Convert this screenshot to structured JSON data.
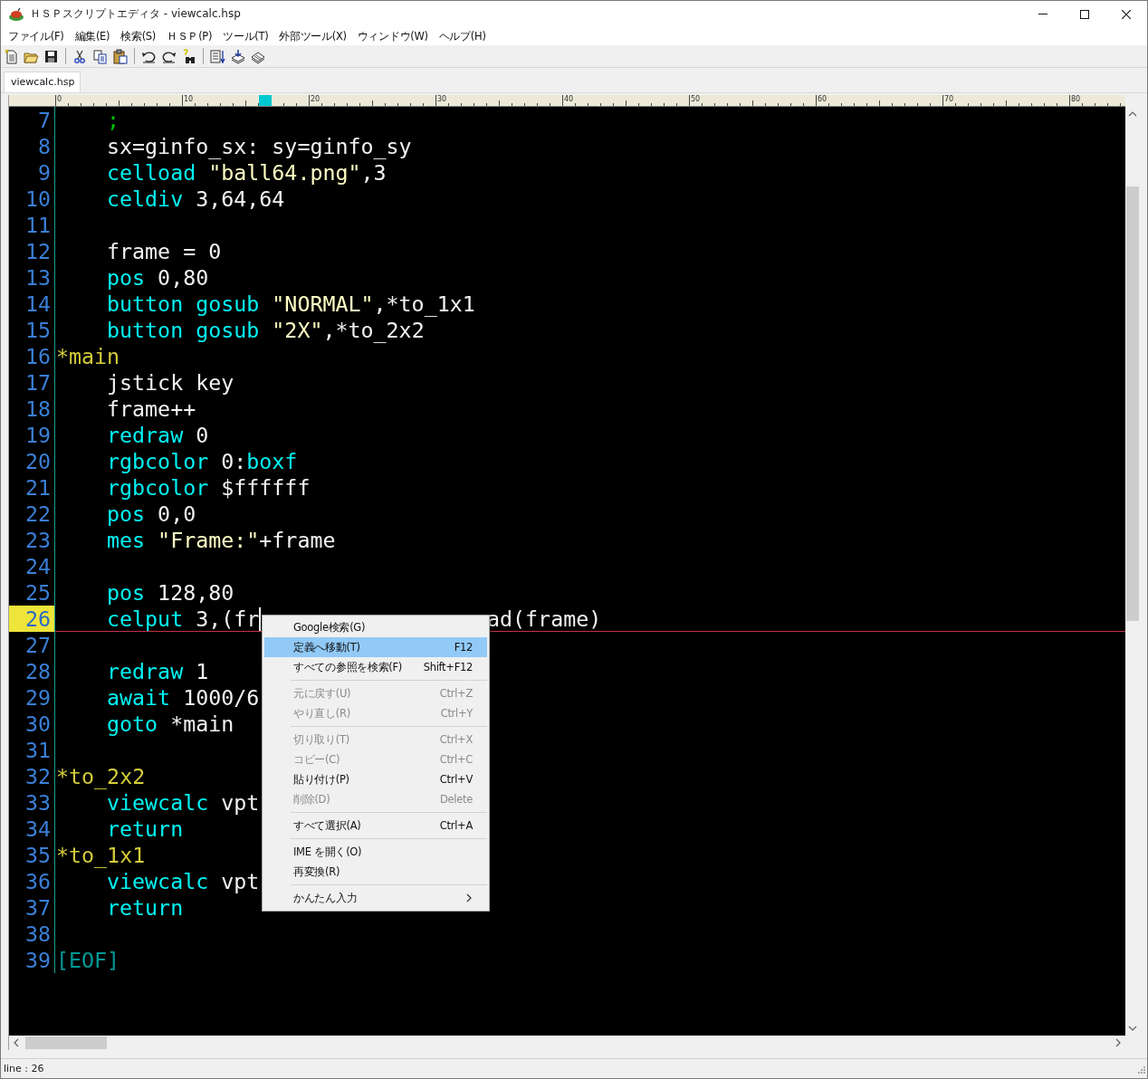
{
  "window": {
    "title": "ＨＳＰスクリプトエディタ - viewcalc.hsp"
  },
  "menu_bar": [
    "ファイル(F)",
    "編集(E)",
    "検索(S)",
    "ＨＳＰ(P)",
    "ツール(T)",
    "外部ツール(X)",
    "ウィンドウ(W)",
    "ヘルプ(H)"
  ],
  "tabs": [
    {
      "label": "viewcalc.hsp",
      "selected": true
    }
  ],
  "ruler": {
    "labels": [
      "0",
      "10",
      "20",
      "30",
      "40",
      "50",
      "60",
      "70",
      "80"
    ],
    "cursor": {
      "level": 0.19
    }
  },
  "editor": {
    "lines": [
      {
        "number": "7",
        "current": false,
        "indent": true,
        "tokens": [
          {
            "kind": "comment",
            "text": ";"
          }
        ]
      },
      {
        "number": "8",
        "current": false,
        "indent": true,
        "tokens": [
          {
            "kind": "plain",
            "text": "sx=ginfo_sx: sy=ginfo_sy"
          }
        ]
      },
      {
        "number": "9",
        "current": false,
        "indent": true,
        "tokens": [
          {
            "kind": "keyword",
            "text": "celload"
          },
          {
            "kind": "string",
            "text": " \"ball64.png\""
          },
          {
            "kind": "plain",
            "text": ",3"
          }
        ]
      },
      {
        "number": "10",
        "current": false,
        "indent": true,
        "tokens": [
          {
            "kind": "keyword",
            "text": "celdiv"
          },
          {
            "kind": "plain",
            "text": " 3,64,64"
          }
        ]
      },
      {
        "number": "11",
        "current": false,
        "indent": false
      },
      {
        "number": "12",
        "current": false,
        "indent": true,
        "tokens": [
          {
            "kind": "plain",
            "text": "frame = 0"
          }
        ]
      },
      {
        "number": "13",
        "current": false,
        "indent": true,
        "tokens": [
          {
            "kind": "keyword",
            "text": "pos"
          },
          {
            "kind": "plain",
            "text": " 0,80"
          }
        ]
      },
      {
        "number": "14",
        "current": false,
        "indent": true,
        "tokens": [
          {
            "kind": "keyword",
            "text": "button gosub"
          },
          {
            "kind": "string",
            "text": " \"NORMAL\""
          },
          {
            "kind": "plain",
            "text": ",*to_1x1"
          }
        ]
      },
      {
        "number": "15",
        "current": false,
        "indent": true,
        "tokens": [
          {
            "kind": "keyword",
            "text": "button gosub"
          },
          {
            "kind": "string",
            "text": " \"2X\""
          },
          {
            "kind": "plain",
            "text": ",*to_2x2"
          }
        ]
      },
      {
        "number": "16",
        "current": false,
        "indent": false,
        "tokens": [
          {
            "kind": "label",
            "text": "*main"
          }
        ]
      },
      {
        "number": "17",
        "current": false,
        "indent": true,
        "tokens": [
          {
            "kind": "plain",
            "text": "jstick key"
          }
        ]
      },
      {
        "number": "18",
        "current": false,
        "indent": true,
        "tokens": [
          {
            "kind": "plain",
            "text": "frame++"
          }
        ]
      },
      {
        "number": "19",
        "current": false,
        "indent": true,
        "tokens": [
          {
            "kind": "keyword",
            "text": "redraw"
          },
          {
            "kind": "plain",
            "text": " 0"
          }
        ]
      },
      {
        "number": "20",
        "current": false,
        "indent": true,
        "tokens": [
          {
            "kind": "keyword",
            "text": "rgbcolor"
          },
          {
            "kind": "plain",
            "text": " 0:"
          },
          {
            "kind": "keyword",
            "text": "boxf"
          }
        ]
      },
      {
        "number": "21",
        "current": false,
        "indent": true,
        "tokens": [
          {
            "kind": "keyword",
            "text": "rgbcolor"
          },
          {
            "kind": "plain",
            "text": " $ffffff"
          }
        ]
      },
      {
        "number": "22",
        "current": false,
        "indent": true,
        "tokens": [
          {
            "kind": "keyword",
            "text": "pos"
          },
          {
            "kind": "plain",
            "text": " 0,0"
          }
        ]
      },
      {
        "number": "23",
        "current": false,
        "indent": true,
        "tokens": [
          {
            "kind": "keyword",
            "text": "mes"
          },
          {
            "kind": "string",
            "text": " \"Frame:\""
          },
          {
            "kind": "plain",
            "text": "+frame"
          }
        ]
      },
      {
        "number": "24",
        "current": false,
        "indent": false
      },
      {
        "number": "25",
        "current": false,
        "indent": true,
        "tokens": [
          {
            "kind": "keyword",
            "text": "pos"
          },
          {
            "kind": "plain",
            "text": " 128,80"
          }
        ]
      },
      {
        "number": "26",
        "current": true,
        "indent": true,
        "tokens": [
          {
            "kind": "keyword",
            "text": "celput"
          },
          {
            "kind": "plain",
            "text": " 3,(fr"
          },
          {
            "kind": "caret"
          },
          {
            "kind": "after_cover",
            "text": "ad(frame)"
          }
        ]
      },
      {
        "number": "27",
        "current": false,
        "indent": false
      },
      {
        "number": "28",
        "current": false,
        "indent": true,
        "tokens": [
          {
            "kind": "keyword",
            "text": "redraw"
          },
          {
            "kind": "plain",
            "text": " 1"
          }
        ]
      },
      {
        "number": "29",
        "current": false,
        "indent": true,
        "tokens": [
          {
            "kind": "keyword",
            "text": "await"
          },
          {
            "kind": "plain",
            "text": " 1000/6"
          }
        ]
      },
      {
        "number": "30",
        "current": false,
        "indent": true,
        "tokens": [
          {
            "kind": "keyword",
            "text": "goto"
          },
          {
            "kind": "plain",
            "text": " *main"
          }
        ]
      },
      {
        "number": "31",
        "current": false,
        "indent": false
      },
      {
        "number": "32",
        "current": false,
        "indent": false,
        "tokens": [
          {
            "kind": "label",
            "text": "*to_2x2"
          }
        ]
      },
      {
        "number": "33",
        "current": false,
        "indent": true,
        "tokens": [
          {
            "kind": "keyword",
            "text": "viewcalc"
          },
          {
            "kind": "plain",
            "text": " vpt"
          }
        ]
      },
      {
        "number": "34",
        "current": false,
        "indent": true,
        "tokens": [
          {
            "kind": "keyword",
            "text": "return"
          }
        ]
      },
      {
        "number": "35",
        "current": false,
        "indent": false,
        "tokens": [
          {
            "kind": "label",
            "text": "*to_1x1"
          }
        ]
      },
      {
        "number": "36",
        "current": false,
        "indent": true,
        "tokens": [
          {
            "kind": "keyword",
            "text": "viewcalc"
          },
          {
            "kind": "plain",
            "text": " vpt"
          }
        ]
      },
      {
        "number": "37",
        "current": false,
        "indent": true,
        "tokens": [
          {
            "kind": "keyword",
            "text": "return"
          }
        ]
      },
      {
        "number": "38",
        "current": false,
        "indent": false
      },
      {
        "number": "39",
        "current": false,
        "indent": false,
        "tokens": [
          {
            "kind": "eof",
            "text": "[EOF]"
          }
        ]
      }
    ]
  },
  "context_menu": {
    "items": [
      {
        "kind": "item",
        "label": "Google検索(G)",
        "disabled": false,
        "selected": false
      },
      {
        "kind": "item",
        "label": "定義へ移動(T)",
        "shortcut": "F12",
        "disabled": false,
        "selected": true
      },
      {
        "kind": "item",
        "label": "すべての参照を検索(F)",
        "shortcut": "Shift+F12",
        "disabled": false,
        "selected": false
      },
      {
        "kind": "separator"
      },
      {
        "kind": "item",
        "label": "元に戻す(U)",
        "shortcut": "Ctrl+Z",
        "disabled": true,
        "selected": false
      },
      {
        "kind": "item",
        "label": "やり直し(R)",
        "shortcut": "Ctrl+Y",
        "disabled": true,
        "selected": false
      },
      {
        "kind": "separator"
      },
      {
        "kind": "item",
        "label": "切り取り(T)",
        "shortcut": "Ctrl+X",
        "disabled": true,
        "selected": false
      },
      {
        "kind": "item",
        "label": "コピー(C)",
        "shortcut": "Ctrl+C",
        "disabled": true,
        "selected": false
      },
      {
        "kind": "item",
        "label": "貼り付け(P)",
        "shortcut": "Ctrl+V",
        "disabled": false,
        "selected": false
      },
      {
        "kind": "item",
        "label": "削除(D)",
        "shortcut": "Delete",
        "disabled": true,
        "selected": false
      },
      {
        "kind": "separator"
      },
      {
        "kind": "item",
        "label": "すべて選択(A)",
        "shortcut": "Ctrl+A",
        "disabled": false,
        "selected": false
      },
      {
        "kind": "separator"
      },
      {
        "kind": "item",
        "label": "IME を開く(O)",
        "disabled": false,
        "selected": false
      },
      {
        "kind": "item",
        "label": "再変換(R)",
        "disabled": false,
        "selected": false
      },
      {
        "kind": "separator"
      },
      {
        "kind": "submenu",
        "label": "かんたん入力",
        "disabled": false,
        "selected": false
      }
    ]
  },
  "status_bar": {
    "text": "line : 26"
  }
}
